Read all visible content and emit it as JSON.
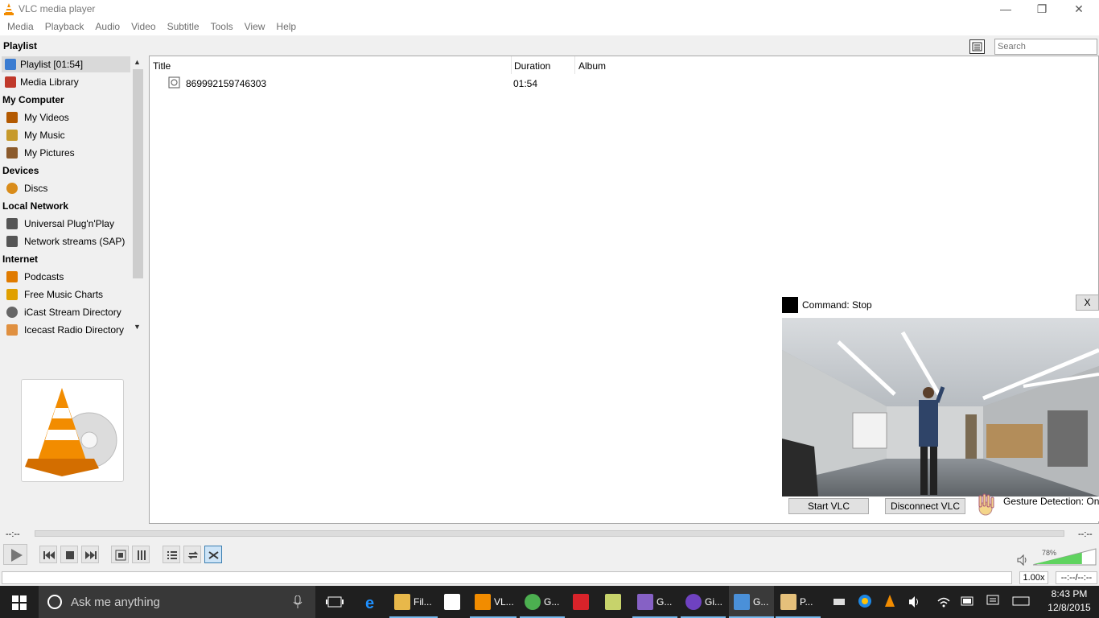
{
  "window": {
    "title": "VLC media player"
  },
  "menu": [
    "Media",
    "Playback",
    "Audio",
    "Video",
    "Subtitle",
    "Tools",
    "View",
    "Help"
  ],
  "sidebar": {
    "title": "Playlist",
    "sections": [
      {
        "header": "",
        "items": [
          {
            "label": "Playlist [01:54]",
            "icon": "playlist-icon",
            "selected": true
          },
          {
            "label": "Media Library",
            "icon": "library-icon"
          }
        ]
      },
      {
        "header": "My Computer",
        "items": [
          {
            "label": "My Videos",
            "icon": "film-icon"
          },
          {
            "label": "My Music",
            "icon": "music-note-icon"
          },
          {
            "label": "My Pictures",
            "icon": "picture-icon"
          }
        ]
      },
      {
        "header": "Devices",
        "items": [
          {
            "label": "Discs",
            "icon": "disc-icon"
          }
        ]
      },
      {
        "header": "Local Network",
        "items": [
          {
            "label": "Universal Plug'n'Play",
            "icon": "network-icon"
          },
          {
            "label": "Network streams (SAP)",
            "icon": "network-icon"
          }
        ]
      },
      {
        "header": "Internet",
        "items": [
          {
            "label": "Podcasts",
            "icon": "podcast-icon"
          },
          {
            "label": "Free Music Charts",
            "icon": "music-chart-icon"
          },
          {
            "label": "iCast Stream Directory",
            "icon": "globe-icon"
          },
          {
            "label": "Icecast Radio Directory",
            "icon": "radio-icon"
          }
        ]
      }
    ]
  },
  "playlist": {
    "search_placeholder": "Search",
    "columns": [
      "Title",
      "Duration",
      "Album"
    ],
    "rows": [
      {
        "title": "869992159746303",
        "duration": "01:54",
        "album": ""
      }
    ]
  },
  "gesture": {
    "command": "Command: Stop",
    "close_label": "X",
    "start_label": "Start VLC",
    "disconnect_label": "Disconnect VLC",
    "detection": "Gesture Detection: On"
  },
  "controls": {
    "elapsed": "--:--",
    "remaining": "--:--",
    "volume": "78%",
    "volume_level": 0.78,
    "rate": "1.00x",
    "time": "--:--/--:--"
  },
  "taskbar": {
    "search_placeholder": "Ask me anything",
    "apps": [
      {
        "label": "Fil...",
        "icon": "file-explorer-icon",
        "color": "#e8b84a"
      },
      {
        "label": "",
        "icon": "store-icon",
        "color": "#ffffff"
      },
      {
        "label": "VL...",
        "icon": "vlc-cone-icon",
        "color": "#f28c00"
      },
      {
        "label": "G...",
        "icon": "chrome-icon",
        "color": "#4caf50"
      },
      {
        "label": "",
        "icon": "pdf-icon",
        "color": "#d8232a"
      },
      {
        "label": "",
        "icon": "notes-icon",
        "color": "#c7d36b"
      },
      {
        "label": "G...",
        "icon": "visual-studio-icon",
        "color": "#8661c5"
      },
      {
        "label": "Gi...",
        "icon": "github-icon",
        "color": "#6f42c1"
      },
      {
        "label": "G...",
        "icon": "app-window-icon",
        "color": "#4a90d9"
      },
      {
        "label": "P...",
        "icon": "paint-icon",
        "color": "#e5c07b"
      }
    ],
    "time": "8:43 PM",
    "date": "12/8/2015"
  }
}
